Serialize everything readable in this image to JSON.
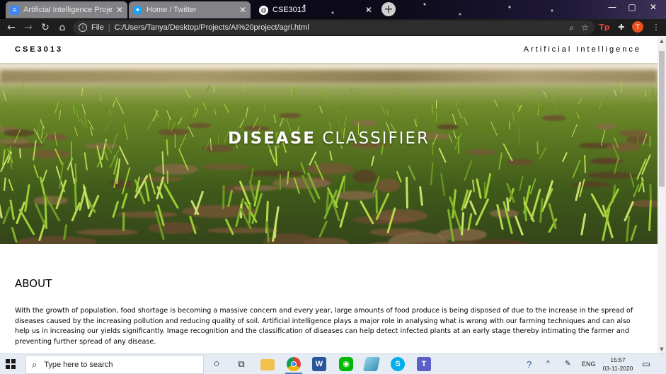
{
  "browser": {
    "tabs": [
      {
        "title": "Artificial Intelligence Project - G",
        "icon": "google-docs-icon",
        "state": "inactive"
      },
      {
        "title": "Home / Twitter",
        "icon": "twitter-icon",
        "state": "inactive"
      },
      {
        "title": "CSE3013",
        "icon": "globe-icon",
        "state": "active"
      }
    ],
    "new_tab_label": "+",
    "address_scheme": "File",
    "address_url": "C:/Users/Tanya/Desktop/Projects/AI%20project/agri.html",
    "profile_initial": "T",
    "extension_label": "Tp",
    "colors": {
      "profile": "#e8521f",
      "toolbar": "#1e1e1e"
    }
  },
  "site": {
    "brand": "CSE3013",
    "nav_link": "Artificial Intelligence",
    "hero": {
      "title_bold": "DISEASE",
      "title_light": "CLASSIFIER"
    },
    "about": {
      "heading": "ABOUT",
      "body": "With the growth of population, food shortage is becoming a massive concern and every year, large amounts of food produce is being disposed of due to the increase in the spread of diseases caused by the increasing pollution and reducing quality of soil. Artificial intelligence plays a major role in analysing what is wrong with our farming techniques and can also help us in increasing our yields significantly. Image recognition and the classification of diseases can help detect infected plants at an early stage thereby intimating the farmer and preventing further spread of any disease."
    }
  },
  "taskbar": {
    "search_placeholder": "Type here to search",
    "apps": [
      "cortana-icon",
      "task-view-icon",
      "file-explorer-icon",
      "chrome-icon",
      "word-icon",
      "line-icon",
      "powershell-icon",
      "skype-icon",
      "teams-icon"
    ],
    "tray": {
      "language": "ENG",
      "time": "15:57",
      "date": "03-11-2020"
    }
  }
}
